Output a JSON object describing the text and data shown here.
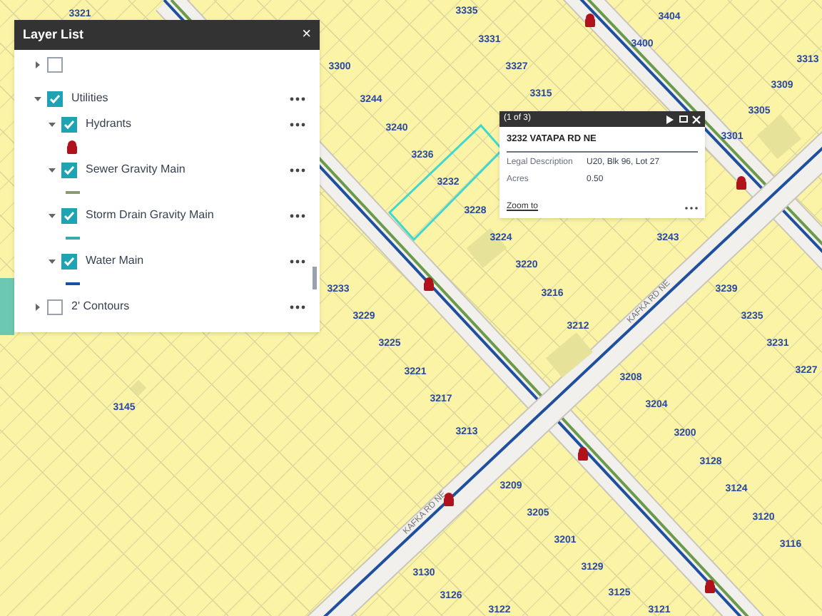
{
  "layer_list": {
    "title": "Layer List",
    "close": "×",
    "items": [
      {
        "checked": false,
        "expanded": false
      },
      {
        "label": "Utilities",
        "checked": true,
        "expanded": true,
        "children": [
          {
            "label": "Hydrants",
            "checked": true,
            "expanded": true,
            "legend": {
              "kind": "hydrant",
              "color": "#b0121b"
            }
          },
          {
            "label": "Sewer Gravity Main",
            "checked": true,
            "expanded": true,
            "legend": {
              "kind": "line",
              "color": "#8a9a72"
            }
          },
          {
            "label": "Storm Drain Gravity Main",
            "checked": true,
            "expanded": true,
            "legend": {
              "kind": "line",
              "color": "#3aa8b0"
            }
          },
          {
            "label": "Water Main",
            "checked": true,
            "expanded": true,
            "legend": {
              "kind": "line",
              "color": "#1f4f9f"
            }
          }
        ]
      },
      {
        "label": "2' Contours",
        "checked": false,
        "expanded": false
      }
    ]
  },
  "popup": {
    "counter": "(1 of 3)",
    "title": "3232 VATAPA RD NE",
    "fields": [
      {
        "label": "Legal Description",
        "value": "U20, Blk 96, Lot 27"
      },
      {
        "label": "Acres",
        "value": "0.50"
      }
    ],
    "link": "Zoom to"
  },
  "map": {
    "parcel_labels": [
      "3321",
      "3335",
      "3404",
      "3400",
      "3331",
      "3300",
      "3327",
      "3313",
      "3315",
      "3244",
      "3309",
      "3305",
      "3240",
      "3301",
      "3236",
      "3232",
      "3228",
      "3243",
      "3224",
      "3220",
      "3233",
      "3216",
      "3239",
      "3229",
      "3212",
      "3235",
      "3225",
      "3231",
      "3221",
      "3208",
      "3227",
      "3217",
      "3204",
      "3145",
      "3213",
      "3200",
      "3128",
      "3209",
      "3124",
      "3205",
      "3120",
      "3201",
      "3116",
      "3129",
      "3130",
      "3125",
      "3126",
      "3122",
      "3121"
    ],
    "road_labels": [
      "KAFKA RD NE",
      "KAFKA RD NE"
    ]
  }
}
